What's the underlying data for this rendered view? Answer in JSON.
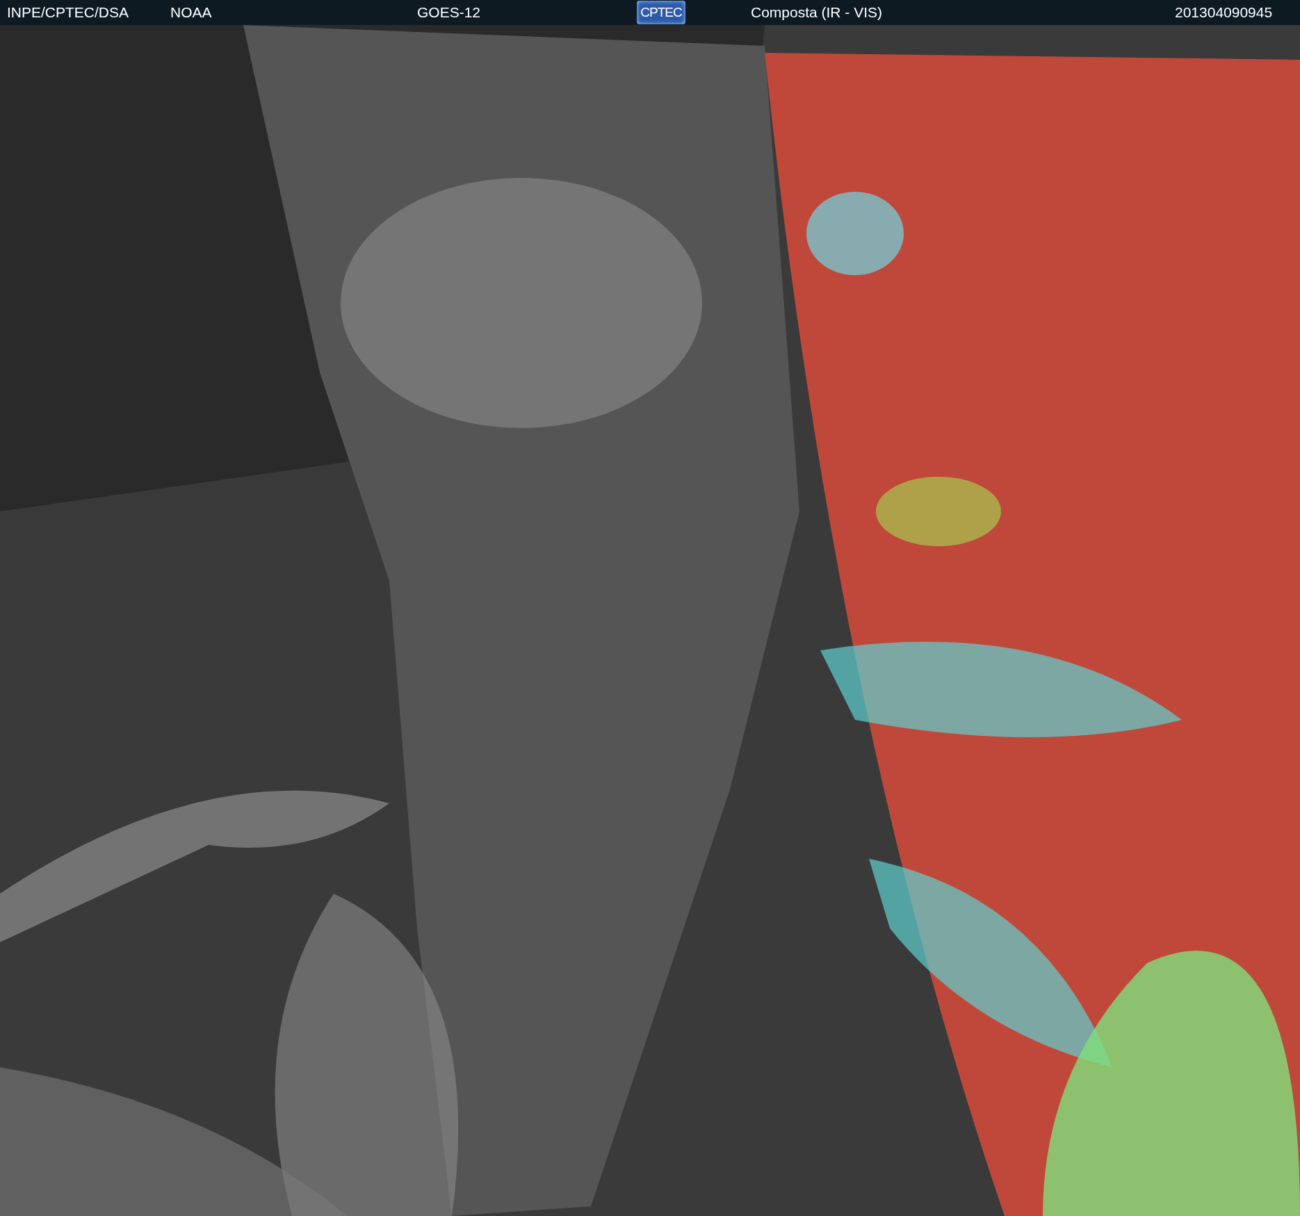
{
  "header": {
    "items": [
      {
        "kind": "text",
        "label": "INPE/CPTEC/DSA"
      },
      {
        "kind": "text",
        "label": "NOAA"
      },
      {
        "kind": "text",
        "label": "GOES-12"
      },
      {
        "kind": "logo",
        "label": "CPTEC"
      },
      {
        "kind": "text",
        "label": "Composta (IR - VIS)"
      },
      {
        "kind": "text",
        "label": "201304090945"
      }
    ]
  }
}
